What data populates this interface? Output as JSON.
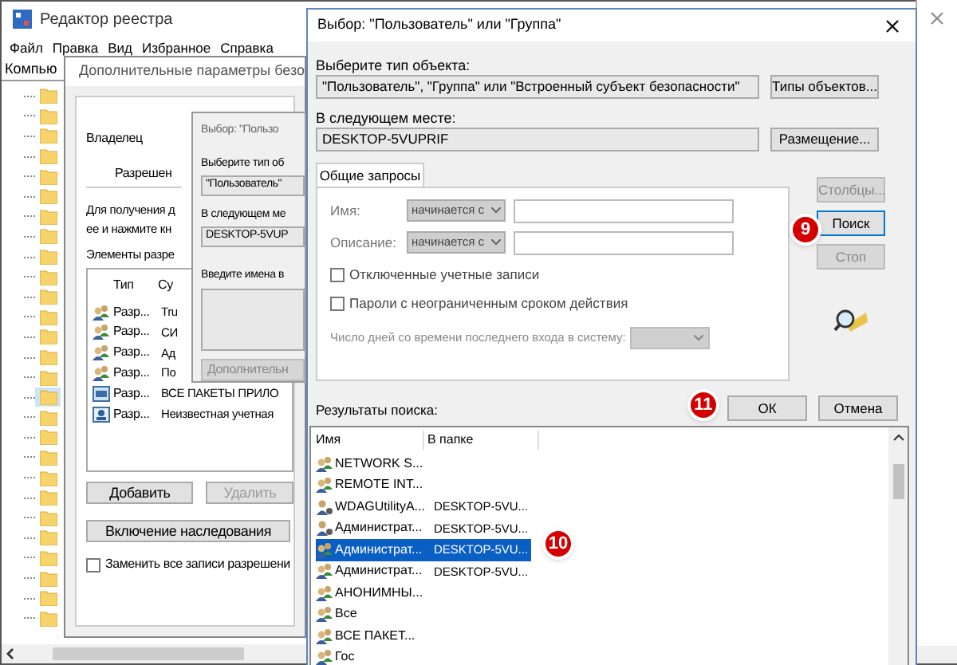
{
  "registry": {
    "title": "Редактор реестра",
    "menu": [
      "Файл",
      "Правка",
      "Вид",
      "Избранное",
      "Справка"
    ],
    "address": "Компью",
    "tree": [
      {
        "selected": false
      },
      {
        "selected": false
      },
      {
        "selected": false
      },
      {
        "selected": false
      },
      {
        "selected": false
      },
      {
        "selected": false
      },
      {
        "selected": false
      },
      {
        "selected": false
      },
      {
        "selected": false
      },
      {
        "selected": false
      },
      {
        "selected": false
      },
      {
        "selected": false
      },
      {
        "selected": false
      },
      {
        "selected": false
      },
      {
        "selected": false
      },
      {
        "selected": true
      },
      {
        "selected": false
      },
      {
        "selected": false
      },
      {
        "selected": false
      },
      {
        "selected": false
      },
      {
        "selected": false
      },
      {
        "selected": false
      },
      {
        "selected": false
      },
      {
        "selected": false
      },
      {
        "selected": false
      },
      {
        "selected": false
      },
      {
        "selected": false
      }
    ]
  },
  "permissions_window": {
    "title": "Дополнительные параметры безо",
    "owner_label": "Владелец",
    "tab": "Разрешен",
    "info_lines": [
      "Для получения д",
      "ее и нажмите кн"
    ],
    "entries_label": "Элементы разре",
    "columns": [
      "Тип",
      "Су"
    ],
    "rows": [
      {
        "kind": "group",
        "type": "Разр...",
        "subject": "Tru"
      },
      {
        "kind": "group",
        "type": "Разр...",
        "subject": "СИ"
      },
      {
        "kind": "group",
        "type": "Разр...",
        "subject": "Ад"
      },
      {
        "kind": "group",
        "type": "Разр...",
        "subject": "По"
      },
      {
        "kind": "package",
        "type": "Разр...",
        "subject": "ВСЕ ПАКЕТЫ ПРИЛО"
      },
      {
        "kind": "unknown",
        "type": "Разр...",
        "subject": "Неизвестная учетная"
      }
    ],
    "buttons": [
      {
        "label": "Добавить",
        "disabled": false
      },
      {
        "label": "Удалить",
        "disabled": true
      }
    ],
    "inherit_button": "Включение наследования",
    "replace_checkbox": {
      "label": "Заменить все записи разрешени",
      "checked": false
    }
  },
  "small_dialog": {
    "title": "Выбор: \"Пользо",
    "object_type_label": "Выберите тип об",
    "object_type_value": "\"Пользователь\"",
    "location_label": "В следующем ме",
    "location_value": "DESKTOP-5VUP",
    "names_label": "Введите имена в",
    "advanced_button": "Дополнительн"
  },
  "dialog": {
    "title": "Выбор: \"Пользователь\" или \"Группа\"",
    "object_type_label": "Выберите тип объекта:",
    "object_type_value": "\"Пользователь\", \"Группа\" или \"Встроенный субъект безопасности\"",
    "object_types_button": "Типы объектов...",
    "location_label": "В следующем месте:",
    "location_value": "DESKTOP-5VUPRIF",
    "location_button": "Размещение...",
    "tab": "Общие запросы",
    "name_label": "Имя:",
    "name_mode": "начинается с",
    "description_label": "Описание:",
    "description_mode": "начинается с",
    "checkboxes": [
      {
        "label": "Отключенные учетные записи",
        "checked": false
      },
      {
        "label": "Пароли с неограниченным сроком действия",
        "checked": false
      }
    ],
    "days_label": "Число дней со времени последнего входа в систему:",
    "side_buttons": [
      {
        "label": "Столбцы...",
        "disabled": true,
        "focused": false
      },
      {
        "label": "Поиск",
        "disabled": false,
        "focused": true
      },
      {
        "label": "Стоп",
        "disabled": true,
        "focused": false
      }
    ],
    "ok_button": "ОК",
    "cancel_button": "Отмена",
    "results_label": "Результаты поиска:",
    "result_columns": [
      "Имя",
      "В папке"
    ],
    "results": [
      {
        "kind": "group",
        "name": "NETWORK S...",
        "selected": false
      },
      {
        "kind": "group",
        "name": "REMOTE INT...",
        "selected": false
      },
      {
        "kind": "user",
        "name": "WDAGUtilityA...",
        "folder": "DESKTOP-5VU...",
        "selected": false
      },
      {
        "kind": "user",
        "name": "Администрат...",
        "folder": "DESKTOP-5VU...",
        "selected": false
      },
      {
        "kind": "group",
        "name": "Администрат...",
        "folder": "DESKTOP-5VU...",
        "selected": true
      },
      {
        "kind": "group",
        "name": "Администрат...",
        "folder": "DESKTOP-5VU...",
        "selected": false
      },
      {
        "kind": "group",
        "name": "АНОНИМНЫ...",
        "selected": false
      },
      {
        "kind": "group",
        "name": "Все",
        "selected": false
      },
      {
        "kind": "group",
        "name": "ВСЕ ПАКЕТ...",
        "selected": false
      },
      {
        "kind": "group",
        "name": "Гос",
        "selected": false
      }
    ]
  },
  "step_badges": [
    "9",
    "10",
    "11"
  ]
}
